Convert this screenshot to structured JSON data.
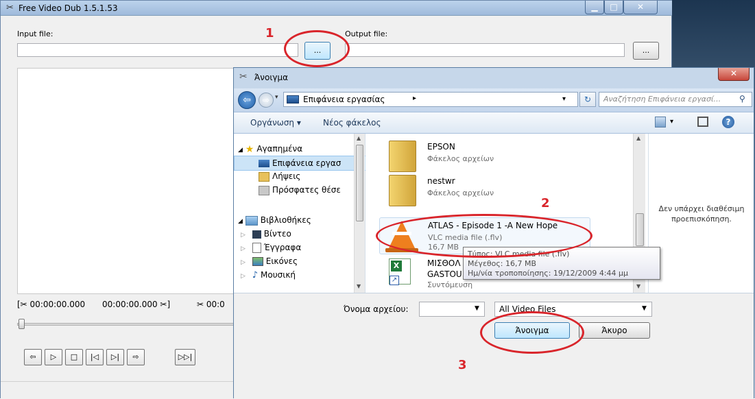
{
  "main": {
    "title": "Free Video Dub 1.5.1.53",
    "input_label": "Input file:",
    "output_label": "Output file:",
    "browse_label": "...",
    "time_start": "[✂ 00:00:00.000",
    "time_end": "00:00:00.000 ✂]",
    "time_current": "✂ 00:0",
    "controls": [
      "⇦",
      "▷",
      "□",
      "|◁",
      "▷|",
      "⇨",
      "▷▷|"
    ]
  },
  "dialog": {
    "title": "Άνοιγμα",
    "address": "Επιφάνεια εργασίας",
    "search_placeholder": "Αναζήτηση Επιφάνεια εργασί...",
    "organize": "Οργάνωση ▾",
    "new_folder": "Νέος φάκελος",
    "nav": {
      "favorites": "Αγαπημένα",
      "desktop": "Επιφάνεια εργασ",
      "downloads": "Λήψεις",
      "recent": "Πρόσφατες θέσε",
      "libraries": "Βιβλιοθήκες",
      "video": "Βίντεο",
      "documents": "Έγγραφα",
      "pictures": "Εικόνες",
      "music": "Μουσική"
    },
    "files": [
      {
        "name": "EPSON",
        "type": "Φάκελος αρχείων"
      },
      {
        "name": "nestwr",
        "type": "Φάκελος αρχείων"
      },
      {
        "name": "ATLAS - Episode 1 -A New Hope",
        "type": "VLC media file (.flv)",
        "size": "16,7 MB"
      },
      {
        "name": "ΜΙΣΘΟΛ",
        "name2": "GASTOU",
        "type": "Συντόμευση"
      }
    ],
    "tooltip": {
      "line1": "Τύπος: VLC media file (.flv)",
      "line2": "Μέγεθος: 16,7 MB",
      "line3": "Ημ/νία τροποποίησης: 19/12/2009 4:44 μμ"
    },
    "preview_text": "Δεν υπάρχει διαθέσιμη προεπισκόπηση.",
    "filename_label": "Όνομα αρχείου:",
    "filter": "All Video Files",
    "open_button": "Άνοιγμα",
    "cancel_button": "Άκυρο"
  },
  "annotations": {
    "step1": "1",
    "step2": "2",
    "step3": "3"
  },
  "colors": {
    "annotation": "#d9252b",
    "selection": "#cce4f7",
    "close": "#c7463b"
  }
}
